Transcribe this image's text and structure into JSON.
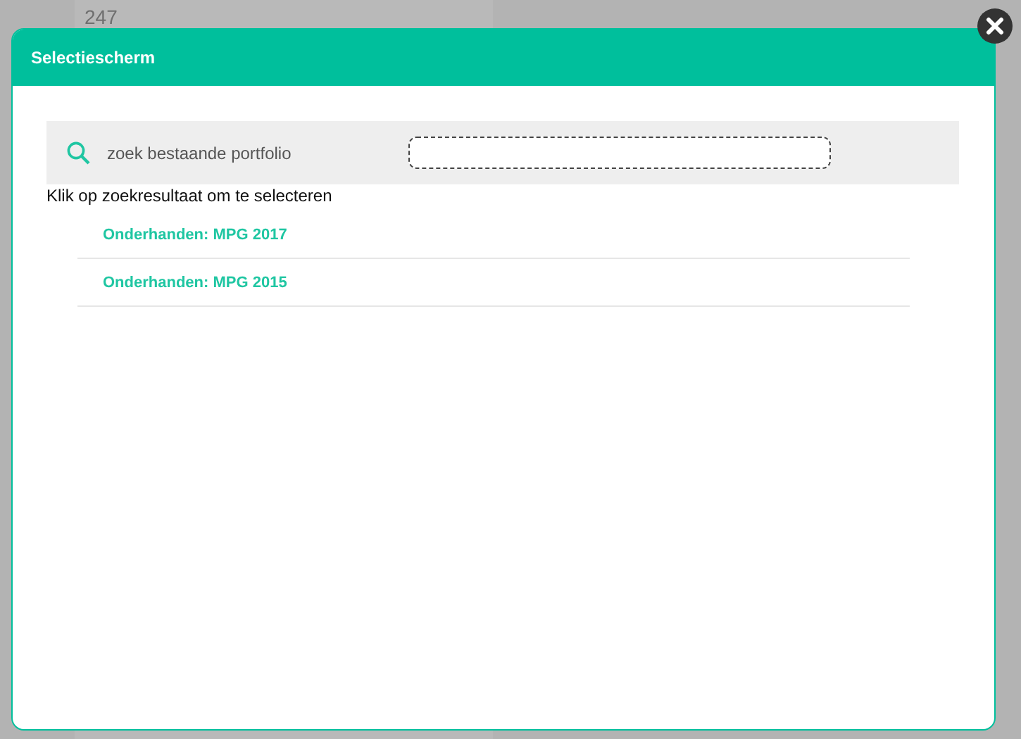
{
  "background": {
    "cell": "247"
  },
  "dialog": {
    "title": "Selectiescherm",
    "search": {
      "label": "zoek bestaande portfolio"
    },
    "hint": "Klik op zoekresultaat om te selecteren",
    "results": [
      {
        "label": "Onderhanden: MPG 2017"
      },
      {
        "label": "Onderhanden: MPG 2015"
      }
    ]
  }
}
